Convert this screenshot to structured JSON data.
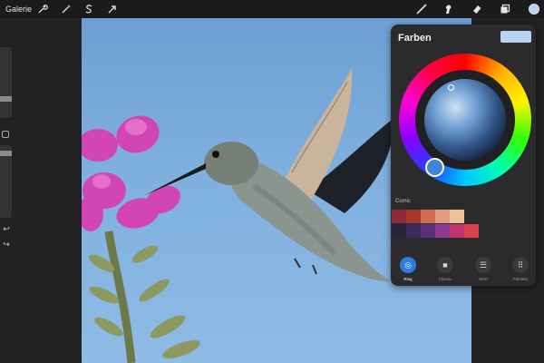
{
  "toolbar": {
    "gallery_label": "Galerie",
    "left_tools": [
      {
        "name": "wrench-icon",
        "glyph": "wrench"
      },
      {
        "name": "magic-wand-icon",
        "glyph": "wand"
      },
      {
        "name": "selection-icon",
        "glyph": "S"
      },
      {
        "name": "transform-icon",
        "glyph": "arrow"
      }
    ],
    "right_tools": [
      {
        "name": "brush-icon"
      },
      {
        "name": "smudge-icon"
      },
      {
        "name": "eraser-icon"
      },
      {
        "name": "layers-icon"
      }
    ],
    "current_color": "#b9d2f0"
  },
  "colors_panel": {
    "title": "Farben",
    "current_color": "#b9d2f0",
    "palette_name": "Comic",
    "swatches_row1": [
      "#8e2a3c",
      "#a8362f",
      "#cf6c56",
      "#e09a84",
      "#e9c29a"
    ],
    "swatches_row2": [
      "#2a2236",
      "#3d2c59",
      "#5b2f7a",
      "#8e3a90",
      "#c03570",
      "#d8404a"
    ],
    "tabs": [
      {
        "label": "Ring",
        "active": true
      },
      {
        "label": "Classic",
        "active": false
      },
      {
        "label": "Wert",
        "active": false
      },
      {
        "label": "Paletten",
        "active": false
      }
    ]
  }
}
